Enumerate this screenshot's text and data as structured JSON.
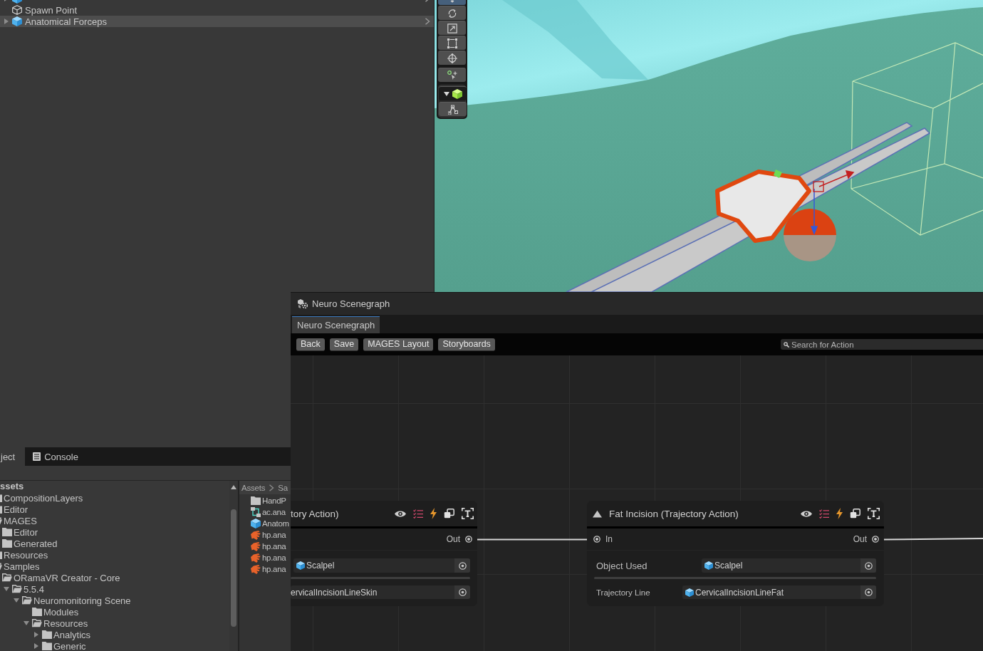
{
  "hierarchy": {
    "items": [
      {
        "kind": "prefab",
        "expanded": false,
        "hovered": false
      },
      {
        "name": "Spawn Point",
        "kind": "gameobject",
        "color": "#c8c8c8",
        "hovered": false
      },
      {
        "name": "Anatomical Forceps",
        "kind": "prefab",
        "color": "#c8c8c8",
        "expanded": false,
        "hovered": true
      }
    ]
  },
  "scene_toolbar": {
    "groups": [
      {
        "tools": [
          {
            "kind": "move",
            "selected": true
          },
          {
            "kind": "rotate",
            "selected": false
          },
          {
            "kind": "scale",
            "selected": false
          },
          {
            "kind": "rect",
            "selected": false
          },
          {
            "kind": "transform",
            "selected": false
          }
        ]
      },
      {
        "tools": [
          {
            "kind": "custom",
            "selected": false
          }
        ]
      },
      {
        "tools": [
          {
            "kind": "component",
            "selected": false
          },
          {
            "kind": "spline",
            "selected": false
          }
        ]
      }
    ]
  },
  "project": {
    "tabs": [
      {
        "label": "ject",
        "kind": "project",
        "selected": true
      },
      {
        "label": "Console",
        "kind": "console",
        "selected": false
      }
    ],
    "tree": {
      "root": "ssets",
      "items": [
        {
          "name": "CompositionLayers"
        },
        {
          "name": "Editor"
        },
        {
          "name": "MAGES",
          "children": [
            {
              "name": "Editor"
            },
            {
              "name": "Generated"
            }
          ]
        },
        {
          "name": "Resources"
        },
        {
          "name": "Samples",
          "children": [
            {
              "name": "ORamaVR Creator - Core",
              "children": [
                {
                  "name": "5.5.4",
                  "expanded": true,
                  "children": [
                    {
                      "name": "Neuromonitoring Scene",
                      "expanded": true,
                      "children": [
                        {
                          "name": "Modules"
                        },
                        {
                          "name": "Resources",
                          "expanded": true,
                          "children": [
                            {
                              "name": "Analytics",
                              "expanded": false
                            },
                            {
                              "name": "Generic",
                              "expanded": false
                            }
                          ]
                        }
                      ]
                    }
                  ]
                }
              ]
            }
          ]
        }
      ]
    },
    "breadcrumb": [
      "Assets",
      "Sa"
    ],
    "files": [
      {
        "kind": "folder",
        "name": "HandP"
      },
      {
        "kind": "animator",
        "name": "ac.ana"
      },
      {
        "kind": "prefab",
        "name": "Anatom"
      },
      {
        "kind": "handpose",
        "name": "hp.ana"
      },
      {
        "kind": "handpose",
        "name": "hp.ana"
      },
      {
        "kind": "handpose",
        "name": "hp.ana"
      },
      {
        "kind": "handpose",
        "name": "hp.ana"
      }
    ]
  },
  "scenegraph": {
    "title": "Neuro Scenegraph",
    "tabs": [
      {
        "label": "Neuro Scenegraph",
        "selected": true
      }
    ],
    "toolbar": {
      "buttons": [
        "Back",
        "Save",
        "MAGES Layout",
        "Storyboards"
      ],
      "search": {
        "placeholder": "Search for Action"
      }
    },
    "nodes": [
      {
        "title": "tory Action)",
        "ports": [
          {
            "kind": "out",
            "label": "Out",
            "connected": true
          }
        ],
        "fields": [
          {
            "kind": "object",
            "value": "Scalpel"
          },
          {
            "kind": "plain",
            "value": "ervicalIncisionLineSkin"
          }
        ]
      },
      {
        "title": "Fat Incision (Trajectory Action)",
        "expanded": true,
        "ports": [
          {
            "kind": "in",
            "label": "In",
            "connected": true
          },
          {
            "kind": "out",
            "label": "Out",
            "connected": true
          }
        ],
        "fields": [
          {
            "label": "Object Used",
            "kind": "object",
            "value": "Scalpel"
          },
          {
            "label": "Trajectory Line",
            "kind": "object",
            "value": "CervicalIncisionLineFat"
          }
        ]
      }
    ]
  }
}
